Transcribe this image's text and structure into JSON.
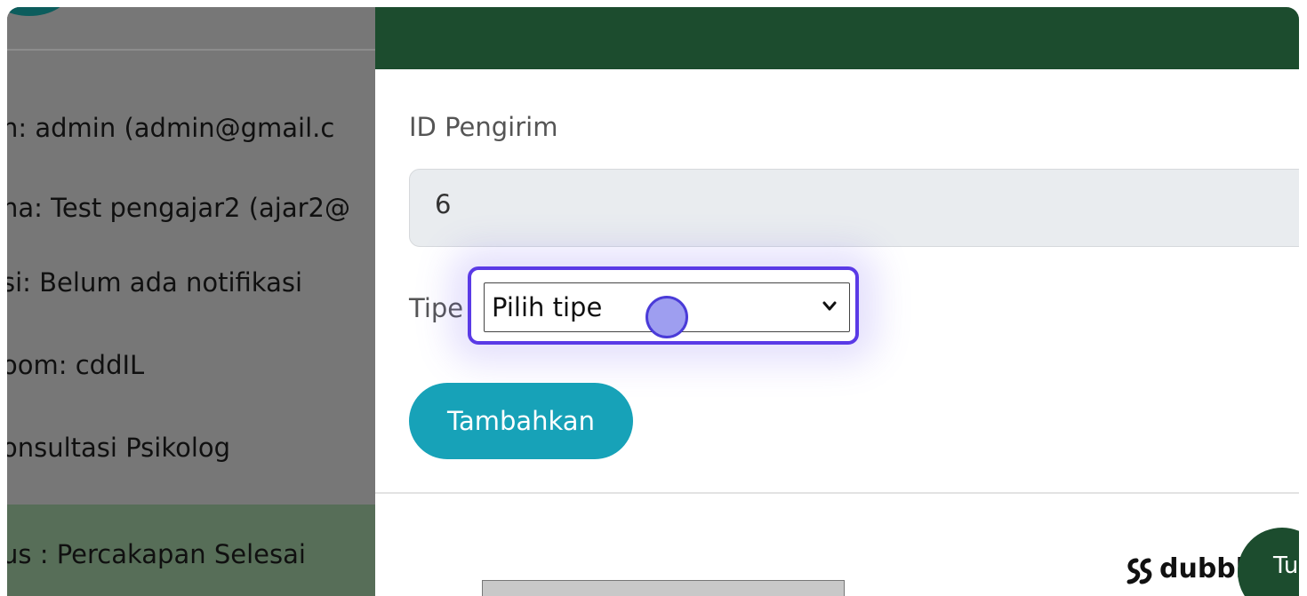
{
  "background_page": {
    "lines": [
      "n: admin (admin@gmail.c",
      "na: Test pengajar2 (ajar2@",
      "si: Belum ada notifikasi",
      "oom: cddIL",
      "onsultasi Psikolog",
      "us : Percakapan Selesai"
    ]
  },
  "modal": {
    "id_label": "ID Pengirim",
    "id_value": "6",
    "tipe_label": "Tipe",
    "select_value": "Pilih tipe",
    "add_button": "Tambahkan",
    "close_button": "Tu"
  },
  "watermark": {
    "text": "dubble"
  },
  "icons": {
    "select": "chevron-down-icon",
    "watermark": "dubble-logo-icon"
  },
  "colors": {
    "header": "#1c4c2e",
    "button": "#17a2b8",
    "highlight": "#5a3ae6",
    "overlay": "#777777"
  }
}
